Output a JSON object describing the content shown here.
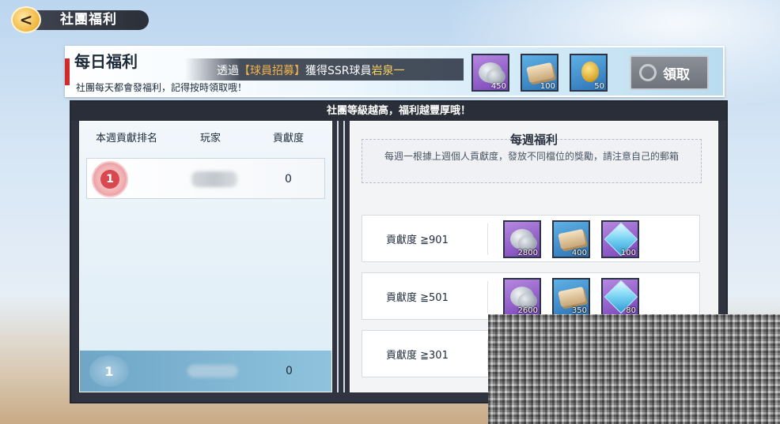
{
  "top_bar": {
    "back_icon": "back-arrow-icon",
    "title": "社團福利"
  },
  "daily": {
    "title": "每日福利",
    "note": "社團每天都會發福利，記得按時領取哦！",
    "promo_prefix": "透過",
    "promo_highlight": "【球員招募】",
    "promo_middle": "獲得SSR球員",
    "promo_player": "岩泉一",
    "rewards": [
      {
        "icon": "silver-coins-icon",
        "qty": "450"
      },
      {
        "icon": "cash-bundle-icon",
        "qty": "100"
      },
      {
        "icon": "gold-medal-icon",
        "qty": "50"
      }
    ],
    "claim_label": "領取"
  },
  "banner": "社團等級越高，福利越豐厚哦！",
  "ranking": {
    "col_rank": "本週貢獻排名",
    "col_player": "玩家",
    "col_contribution": "貢獻度",
    "rows": [
      {
        "rank": "1",
        "contribution": "0"
      }
    ],
    "self": {
      "rank": "1",
      "contribution": "0"
    }
  },
  "weekly": {
    "title": "每週福利",
    "desc": "每週一根據上週個人貢獻度，發放不同檔位的獎勵，請注意自己的郵箱",
    "tiers": [
      {
        "label": "貢獻度 ≧901",
        "items": [
          {
            "icon": "silver-coins-icon",
            "qty": "2800"
          },
          {
            "icon": "cash-bundle-icon",
            "qty": "400"
          },
          {
            "icon": "diamond-icon",
            "qty": "100"
          }
        ]
      },
      {
        "label": "貢獻度 ≧501",
        "items": [
          {
            "icon": "silver-coins-icon",
            "qty": "2600"
          },
          {
            "icon": "cash-bundle-icon",
            "qty": "350"
          },
          {
            "icon": "diamond-icon",
            "qty": "80"
          }
        ]
      },
      {
        "label": "貢獻度 ≧301",
        "items": []
      }
    ]
  },
  "colors": {
    "accent_red": "#d22a2a",
    "promo_highlight": "#f3b34a",
    "panel_dark": "#2f3440"
  }
}
